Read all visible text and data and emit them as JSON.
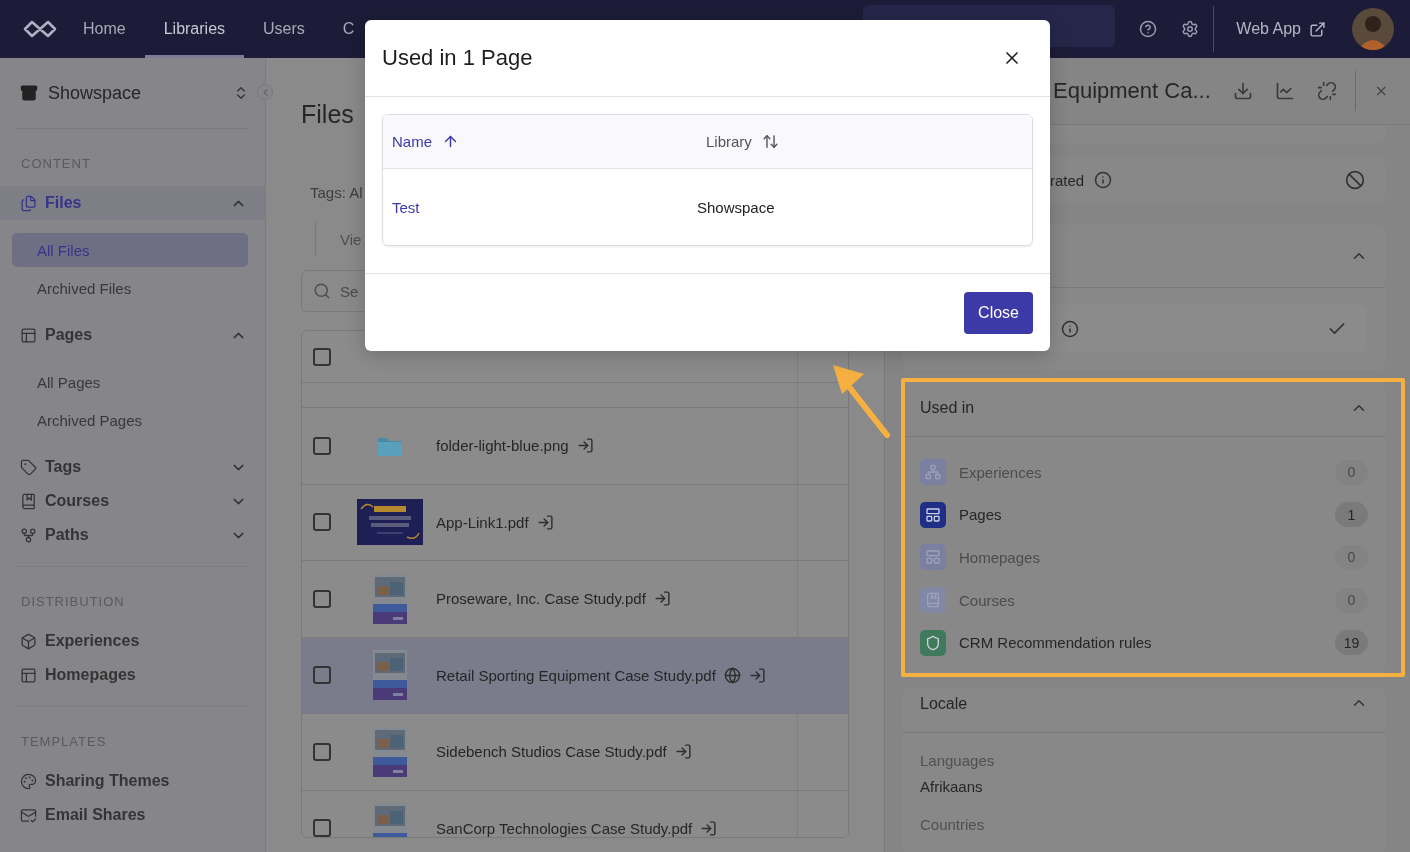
{
  "nav": {
    "items": [
      {
        "label": "Home",
        "selected": false
      },
      {
        "label": "Libraries",
        "selected": true
      },
      {
        "label": "Users",
        "selected": false
      },
      {
        "label": "C",
        "selected": false
      }
    ],
    "web_app": "Web App"
  },
  "sidebar": {
    "workspace": "Showspace",
    "sections": [
      {
        "heading": "CONTENT",
        "items": [
          {
            "label": "Files",
            "selected": true,
            "expanded": true,
            "children": [
              {
                "label": "All Files",
                "selected": true
              },
              {
                "label": "Archived Files",
                "selected": false
              }
            ]
          },
          {
            "label": "Pages",
            "selected": false,
            "expanded": true,
            "children": [
              {
                "label": "All Pages",
                "selected": false
              },
              {
                "label": "Archived Pages",
                "selected": false
              }
            ]
          },
          {
            "label": "Tags",
            "selected": false,
            "expanded": false
          },
          {
            "label": "Courses",
            "selected": false,
            "expanded": false
          },
          {
            "label": "Paths",
            "selected": false,
            "expanded": false
          }
        ]
      },
      {
        "heading": "DISTRIBUTION",
        "items": [
          {
            "label": "Experiences",
            "selected": false
          },
          {
            "label": "Homepages",
            "selected": false
          }
        ]
      },
      {
        "heading": "TEMPLATES",
        "items": [
          {
            "label": "Sharing Themes",
            "selected": false
          },
          {
            "label": "Email Shares",
            "selected": false
          }
        ]
      }
    ]
  },
  "files": {
    "title": "Files",
    "tags_label": "Tags: Al",
    "view_label": "Vie",
    "search": {
      "placeholder": "Se"
    },
    "header_checkbox": {
      "checked": false
    },
    "rows": [
      {
        "name": "folder-light-blue.png",
        "public": false,
        "checked": false,
        "selected": false
      },
      {
        "name": "App-Link1.pdf",
        "public": false,
        "checked": false,
        "selected": false
      },
      {
        "name": "Proseware, Inc. Case Study.pdf",
        "public": false,
        "checked": false,
        "selected": false
      },
      {
        "name": "Retail Sporting Equipment Case Study.pdf",
        "public": true,
        "checked": false,
        "selected": true
      },
      {
        "name": "Sidebench Studios Case Study.pdf",
        "public": false,
        "checked": false,
        "selected": false
      },
      {
        "name": "SanCorp Technologies Case Study.pdf",
        "public": false,
        "checked": false,
        "selected": false
      }
    ]
  },
  "panel": {
    "title": "Equipment Ca...",
    "status_row": {
      "label": "rated"
    },
    "group": {
      "expanded": true
    },
    "used_in": {
      "title": "Used in",
      "expanded": true,
      "items": [
        {
          "label": "Experiences",
          "count": "0",
          "color": "#7b80a0",
          "disabled": true
        },
        {
          "label": "Pages",
          "count": "1",
          "color": "#1f2f86",
          "disabled": false
        },
        {
          "label": "Homepages",
          "count": "0",
          "color": "#7b80a0",
          "disabled": true
        },
        {
          "label": "Courses",
          "count": "0",
          "color": "#8088a4",
          "disabled": true
        },
        {
          "label": "CRM Recommendation rules",
          "count": "19",
          "color": "#3f7a5c",
          "disabled": false
        }
      ]
    },
    "locale": {
      "title": "Locale",
      "expanded": true,
      "fields": [
        {
          "label": "Languages",
          "value": "Afrikaans"
        },
        {
          "label": "Countries"
        }
      ]
    }
  },
  "modal": {
    "title": "Used in 1 Page",
    "columns": [
      {
        "label": "Name",
        "sorted": true
      },
      {
        "label": "Library",
        "sorted": false
      }
    ],
    "rows": [
      {
        "name": "Test",
        "library": "Showspace"
      }
    ],
    "buttons": [
      "Close"
    ]
  }
}
